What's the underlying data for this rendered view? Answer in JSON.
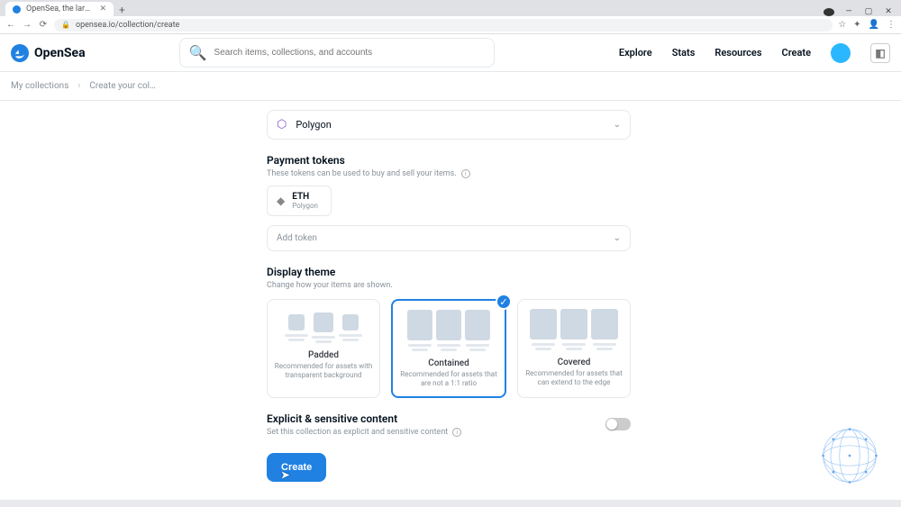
{
  "browser": {
    "tab_title": "OpenSea, the largest NFT mark…",
    "url": "opensea.io/collection/create"
  },
  "header": {
    "brand": "OpenSea",
    "search_placeholder": "Search items, collections, and accounts",
    "nav": {
      "explore": "Explore",
      "stats": "Stats",
      "resources": "Resources",
      "create": "Create"
    }
  },
  "breadcrumb": {
    "root": "My collections",
    "current": "Create your col…"
  },
  "blockchain": {
    "selected": "Polygon"
  },
  "payment": {
    "title": "Payment tokens",
    "sub": "These tokens can be used to buy and sell your items.",
    "token": {
      "symbol": "ETH",
      "chain": "Polygon"
    },
    "add_placeholder": "Add token"
  },
  "display": {
    "title": "Display theme",
    "sub": "Change how your items are shown.",
    "themes": {
      "padded": {
        "title": "Padded",
        "desc": "Recommended for assets with transparent background"
      },
      "contained": {
        "title": "Contained",
        "desc": "Recommended for assets that are not a 1:1 ratio"
      },
      "covered": {
        "title": "Covered",
        "desc": "Recommended for assets that can extend to the edge"
      }
    }
  },
  "explicit": {
    "title": "Explicit & sensitive content",
    "sub": "Set this collection as explicit and sensitive content"
  },
  "submit": {
    "label": "Create"
  }
}
